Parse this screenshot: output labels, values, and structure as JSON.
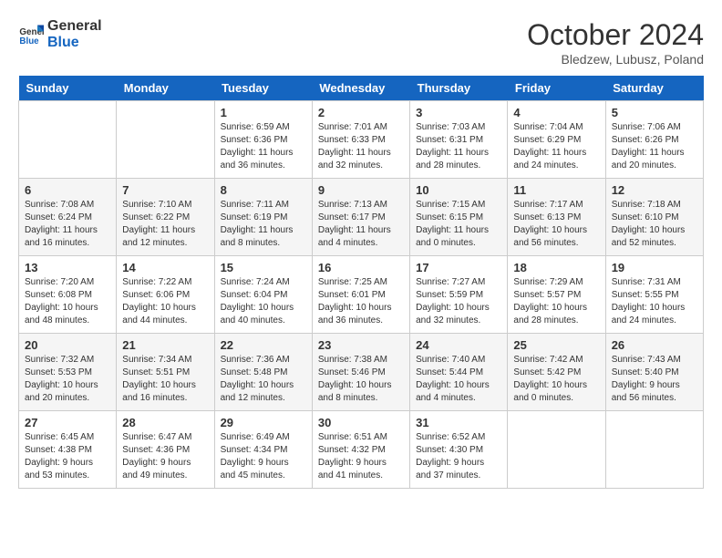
{
  "header": {
    "logo_line1": "General",
    "logo_line2": "Blue",
    "month": "October 2024",
    "location": "Bledzew, Lubusz, Poland"
  },
  "days_of_week": [
    "Sunday",
    "Monday",
    "Tuesday",
    "Wednesday",
    "Thursday",
    "Friday",
    "Saturday"
  ],
  "weeks": [
    [
      {
        "num": "",
        "info": ""
      },
      {
        "num": "",
        "info": ""
      },
      {
        "num": "1",
        "info": "Sunrise: 6:59 AM\nSunset: 6:36 PM\nDaylight: 11 hours and 36 minutes."
      },
      {
        "num": "2",
        "info": "Sunrise: 7:01 AM\nSunset: 6:33 PM\nDaylight: 11 hours and 32 minutes."
      },
      {
        "num": "3",
        "info": "Sunrise: 7:03 AM\nSunset: 6:31 PM\nDaylight: 11 hours and 28 minutes."
      },
      {
        "num": "4",
        "info": "Sunrise: 7:04 AM\nSunset: 6:29 PM\nDaylight: 11 hours and 24 minutes."
      },
      {
        "num": "5",
        "info": "Sunrise: 7:06 AM\nSunset: 6:26 PM\nDaylight: 11 hours and 20 minutes."
      }
    ],
    [
      {
        "num": "6",
        "info": "Sunrise: 7:08 AM\nSunset: 6:24 PM\nDaylight: 11 hours and 16 minutes."
      },
      {
        "num": "7",
        "info": "Sunrise: 7:10 AM\nSunset: 6:22 PM\nDaylight: 11 hours and 12 minutes."
      },
      {
        "num": "8",
        "info": "Sunrise: 7:11 AM\nSunset: 6:19 PM\nDaylight: 11 hours and 8 minutes."
      },
      {
        "num": "9",
        "info": "Sunrise: 7:13 AM\nSunset: 6:17 PM\nDaylight: 11 hours and 4 minutes."
      },
      {
        "num": "10",
        "info": "Sunrise: 7:15 AM\nSunset: 6:15 PM\nDaylight: 11 hours and 0 minutes."
      },
      {
        "num": "11",
        "info": "Sunrise: 7:17 AM\nSunset: 6:13 PM\nDaylight: 10 hours and 56 minutes."
      },
      {
        "num": "12",
        "info": "Sunrise: 7:18 AM\nSunset: 6:10 PM\nDaylight: 10 hours and 52 minutes."
      }
    ],
    [
      {
        "num": "13",
        "info": "Sunrise: 7:20 AM\nSunset: 6:08 PM\nDaylight: 10 hours and 48 minutes."
      },
      {
        "num": "14",
        "info": "Sunrise: 7:22 AM\nSunset: 6:06 PM\nDaylight: 10 hours and 44 minutes."
      },
      {
        "num": "15",
        "info": "Sunrise: 7:24 AM\nSunset: 6:04 PM\nDaylight: 10 hours and 40 minutes."
      },
      {
        "num": "16",
        "info": "Sunrise: 7:25 AM\nSunset: 6:01 PM\nDaylight: 10 hours and 36 minutes."
      },
      {
        "num": "17",
        "info": "Sunrise: 7:27 AM\nSunset: 5:59 PM\nDaylight: 10 hours and 32 minutes."
      },
      {
        "num": "18",
        "info": "Sunrise: 7:29 AM\nSunset: 5:57 PM\nDaylight: 10 hours and 28 minutes."
      },
      {
        "num": "19",
        "info": "Sunrise: 7:31 AM\nSunset: 5:55 PM\nDaylight: 10 hours and 24 minutes."
      }
    ],
    [
      {
        "num": "20",
        "info": "Sunrise: 7:32 AM\nSunset: 5:53 PM\nDaylight: 10 hours and 20 minutes."
      },
      {
        "num": "21",
        "info": "Sunrise: 7:34 AM\nSunset: 5:51 PM\nDaylight: 10 hours and 16 minutes."
      },
      {
        "num": "22",
        "info": "Sunrise: 7:36 AM\nSunset: 5:48 PM\nDaylight: 10 hours and 12 minutes."
      },
      {
        "num": "23",
        "info": "Sunrise: 7:38 AM\nSunset: 5:46 PM\nDaylight: 10 hours and 8 minutes."
      },
      {
        "num": "24",
        "info": "Sunrise: 7:40 AM\nSunset: 5:44 PM\nDaylight: 10 hours and 4 minutes."
      },
      {
        "num": "25",
        "info": "Sunrise: 7:42 AM\nSunset: 5:42 PM\nDaylight: 10 hours and 0 minutes."
      },
      {
        "num": "26",
        "info": "Sunrise: 7:43 AM\nSunset: 5:40 PM\nDaylight: 9 hours and 56 minutes."
      }
    ],
    [
      {
        "num": "27",
        "info": "Sunrise: 6:45 AM\nSunset: 4:38 PM\nDaylight: 9 hours and 53 minutes."
      },
      {
        "num": "28",
        "info": "Sunrise: 6:47 AM\nSunset: 4:36 PM\nDaylight: 9 hours and 49 minutes."
      },
      {
        "num": "29",
        "info": "Sunrise: 6:49 AM\nSunset: 4:34 PM\nDaylight: 9 hours and 45 minutes."
      },
      {
        "num": "30",
        "info": "Sunrise: 6:51 AM\nSunset: 4:32 PM\nDaylight: 9 hours and 41 minutes."
      },
      {
        "num": "31",
        "info": "Sunrise: 6:52 AM\nSunset: 4:30 PM\nDaylight: 9 hours and 37 minutes."
      },
      {
        "num": "",
        "info": ""
      },
      {
        "num": "",
        "info": ""
      }
    ]
  ]
}
